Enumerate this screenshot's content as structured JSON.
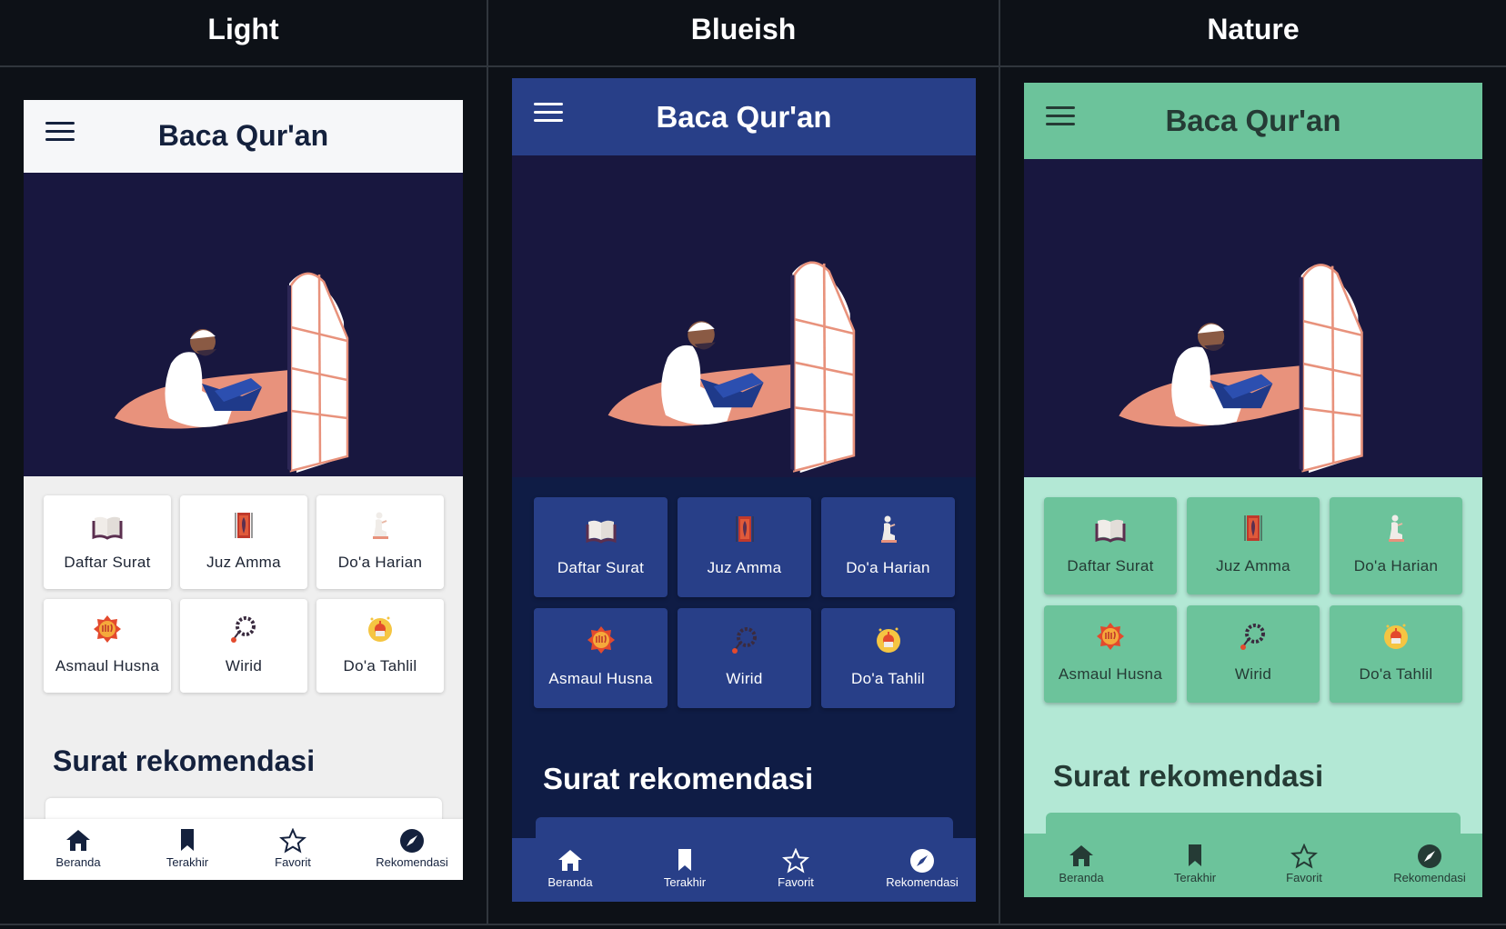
{
  "columns": [
    {
      "heading": "Light"
    },
    {
      "heading": "Blueish"
    },
    {
      "heading": "Nature"
    }
  ],
  "app": {
    "title": "Baca Qur'an",
    "menu": [
      {
        "label": "Daftar Surat",
        "icon": "open-book-icon"
      },
      {
        "label": "Juz Amma",
        "icon": "prayer-rug-icon"
      },
      {
        "label": "Do'a Harian",
        "icon": "praying-person-icon"
      },
      {
        "label": "Asmaul Husna",
        "icon": "allah-emblem-icon"
      },
      {
        "label": "Wirid",
        "icon": "prayer-beads-icon"
      },
      {
        "label": "Do'a Tahlil",
        "icon": "crescent-moon-mosque-icon"
      }
    ],
    "section_title": "Surat rekomendasi",
    "bottom_nav": [
      {
        "label": "Beranda",
        "icon": "home-icon"
      },
      {
        "label": "Terakhir",
        "icon": "bookmark-icon"
      },
      {
        "label": "Favorit",
        "icon": "star-icon"
      },
      {
        "label": "Rekomendasi",
        "icon": "compass-icon"
      }
    ]
  },
  "themes": [
    {
      "name": "Light",
      "appbar_bg": "#f6f7f9",
      "appbar_fg": "#14213d",
      "content_bg": "#efefef",
      "card_bg": "#ffffff",
      "card_fg": "#1d2433",
      "section_fg": "#14213d",
      "nav_bg": "#ffffff",
      "nav_fg": "#14213d"
    },
    {
      "name": "Blueish",
      "appbar_bg": "#283f88",
      "appbar_fg": "#ffffff",
      "content_bg": "#0f1c45",
      "card_bg": "#283f88",
      "card_fg": "#ffffff",
      "section_fg": "#ffffff",
      "nav_bg": "#283f88",
      "nav_fg": "#ffffff"
    },
    {
      "name": "Nature",
      "appbar_bg": "#6cc39b",
      "appbar_fg": "#253b35",
      "content_bg": "#b3e8d5",
      "card_bg": "#6cc39b",
      "card_fg": "#253b35",
      "section_fg": "#253b35",
      "nav_bg": "#6cc39b",
      "nav_fg": "#253b35"
    }
  ]
}
